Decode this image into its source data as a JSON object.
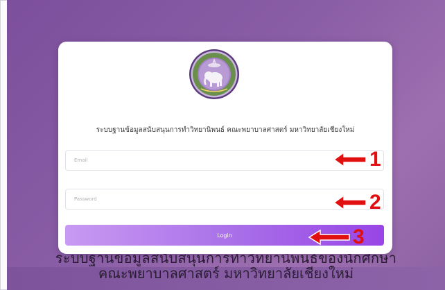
{
  "page": {
    "background_color": "#8a5ea6",
    "background_title_line1": "ระบบฐานข้อมูลสนับสนุนการทำวิทยานิพนธ์ของนักศึกษา",
    "background_title_line2": "คณะพยาบาลศาสตร์ มหาวิทยาลัยเชียงใหม่"
  },
  "login_card": {
    "logo_icon": "university-seal-elephant",
    "seal_text": "มหาวิทยาลัยเชียงใหม่",
    "subtitle": "ระบบฐานข้อมูลสนับสนุนการทำวิทยานิพนธ์ คณะพยาบาลศาสตร์ มหาวิทยาลัยเชียงใหม่",
    "email_placeholder": "Email",
    "password_placeholder": "Password",
    "login_label": "Login",
    "login_button_color": "#a86ee8"
  },
  "annotations": [
    {
      "number": "1",
      "icon": "red-left-arrow",
      "color": "#e10f0f"
    },
    {
      "number": "2",
      "icon": "red-left-arrow",
      "color": "#e10f0f"
    },
    {
      "number": "3",
      "icon": "red-left-arrow",
      "color": "#e10f0f"
    }
  ]
}
